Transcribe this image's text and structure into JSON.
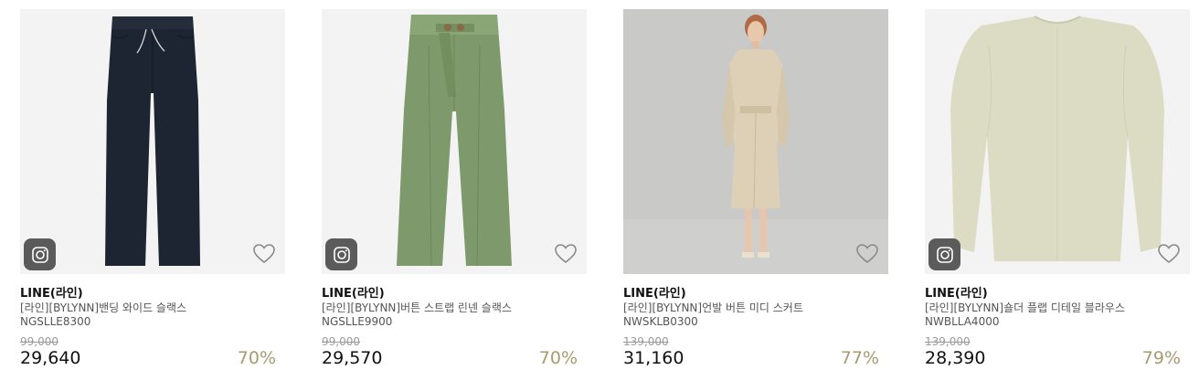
{
  "accent_color": "#a89a6f",
  "products": [
    {
      "brand": "LINE(라인)",
      "name": "[라인][BYLYNN]밴딩 와이드 슬랙스",
      "code": "NGSLLE8300",
      "original_price": "99,000",
      "price": "29,640",
      "discount": "70%",
      "icon": "instagram-icon",
      "color": "#1e2532"
    },
    {
      "brand": "LINE(라인)",
      "name": "[라인][BYLYNN]버튼 스트랩 린넨 슬랙스",
      "code": "NGSLLE9900",
      "original_price": "99,000",
      "price": "29,570",
      "discount": "70%",
      "icon": "instagram-icon",
      "color": "#7e9a6c"
    },
    {
      "brand": "LINE(라인)",
      "name": "[라인][BYLYNN]언발 버튼 미디 스커트",
      "code": "NWSKLB0300",
      "original_price": "139,000",
      "price": "31,160",
      "discount": "77%",
      "color": "#ddd0b6"
    },
    {
      "brand": "LINE(라인)",
      "name": "[라인][BYLYNN]숄더 플랩 디테일 블라우스",
      "code": "NWBLLA4000",
      "original_price": "139,000",
      "price": "28,390",
      "discount": "79%",
      "icon": "instagram-icon",
      "color": "#dcdcc4"
    }
  ]
}
